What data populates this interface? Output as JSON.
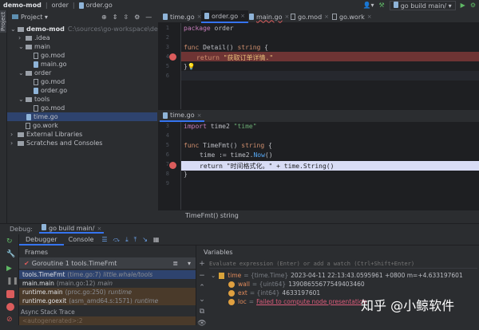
{
  "titlebar": {
    "project": "demo-mod",
    "crumb1": "order",
    "crumb2": "order.go",
    "run_config": "go build main/"
  },
  "sidebar": {
    "strip_label": "Project",
    "header": "Project",
    "tree": [
      {
        "label": "demo-mod",
        "extra": "C:\\sources\\go-workspace\\demo-mod",
        "icon": "module",
        "indent": 0,
        "arrow": "v"
      },
      {
        "label": ".idea",
        "icon": "folder",
        "indent": 1,
        "arrow": ">"
      },
      {
        "label": "main",
        "icon": "folder",
        "indent": 1,
        "arrow": "v"
      },
      {
        "label": "go.mod",
        "icon": "mod",
        "indent": 2
      },
      {
        "label": "main.go",
        "icon": "go",
        "indent": 2
      },
      {
        "label": "order",
        "icon": "folder",
        "indent": 1,
        "arrow": "v"
      },
      {
        "label": "go.mod",
        "icon": "mod",
        "indent": 2
      },
      {
        "label": "order.go",
        "icon": "go",
        "indent": 2
      },
      {
        "label": "tools",
        "icon": "folder",
        "indent": 1,
        "arrow": "v"
      },
      {
        "label": "go.mod",
        "icon": "mod",
        "indent": 2
      },
      {
        "label": "time.go",
        "icon": "go",
        "indent": 2
      },
      {
        "label": "go.work",
        "icon": "mod",
        "indent": 1
      },
      {
        "label": "External Libraries",
        "icon": "lib",
        "indent": 0,
        "arrow": ">"
      },
      {
        "label": "Scratches and Consoles",
        "icon": "scratch",
        "indent": 0,
        "arrow": ">"
      }
    ]
  },
  "editor_tabs": [
    "time.go",
    "order.go",
    "main.go",
    "go.mod",
    "go.work"
  ],
  "editor1": {
    "lines": [
      "1",
      "2",
      "3",
      "4",
      "5",
      "6"
    ],
    "code": {
      "l1a": "package",
      "l1b": " order",
      "l3a": "func",
      "l3b": " Detail() ",
      "l3c": "string",
      "l3d": " {",
      "l4a": "return",
      "l4b": " \"获取订单详情.\"",
      "l5": "}"
    }
  },
  "editor2": {
    "tab": "time.go",
    "lines": [
      "3",
      "4",
      "5",
      "6",
      "7",
      "8",
      "9"
    ],
    "code": {
      "l3a": "import",
      "l3b": " time2 ",
      "l3c": "\"time\"",
      "l5a": "func",
      "l5b": " TimeFmt() ",
      "l5c": "string",
      "l5d": " {",
      "l6a": "time := time2.",
      "l6b": "Now",
      "l6c": "()",
      "l7": "return \"时间格式化。\" + time.String()",
      "l8": "}"
    },
    "breadcrumb": "TimeFmt() string"
  },
  "debug": {
    "label": "Debug:",
    "session": "go build main/",
    "tabs": [
      "Debugger",
      "Console"
    ],
    "frames_header": "Frames",
    "variables_header": "Variables",
    "goroutine": "Goroutine 1 tools.TimeFmt",
    "frames": [
      {
        "name": "tools.TimeFmt",
        "loc": "(time.go:7)",
        "pkg": "little.whale/tools"
      },
      {
        "name": "main.main",
        "loc": "(main.go:12)",
        "pkg": "main"
      },
      {
        "name": "runtime.main",
        "loc": "(proc.go:250)",
        "pkg": "runtime"
      },
      {
        "name": "runtime.goexit",
        "loc": "(asm_amd64.s:1571)",
        "pkg": "runtime"
      }
    ],
    "async": "Async Stack Trace",
    "autogen": "<autogenerated>:2",
    "eval_placeholder": "Evaluate expression (Enter) or add a watch (Ctrl+Shift+Enter)",
    "vars": [
      {
        "name": "time",
        "type": "= {time.Time}",
        "value": "2023-04-11 22:13:43.0595961 +0800 m=+4.633197601"
      },
      {
        "name": "wall",
        "type": "= {uint64}",
        "value": "13908655677549403460"
      },
      {
        "name": "ext",
        "type": "= {int64}",
        "value": "4633197601"
      },
      {
        "name": "loc",
        "type": "=",
        "value": "Failed to compute node presentation"
      }
    ]
  },
  "watermark": "知乎 @小鲸软件"
}
